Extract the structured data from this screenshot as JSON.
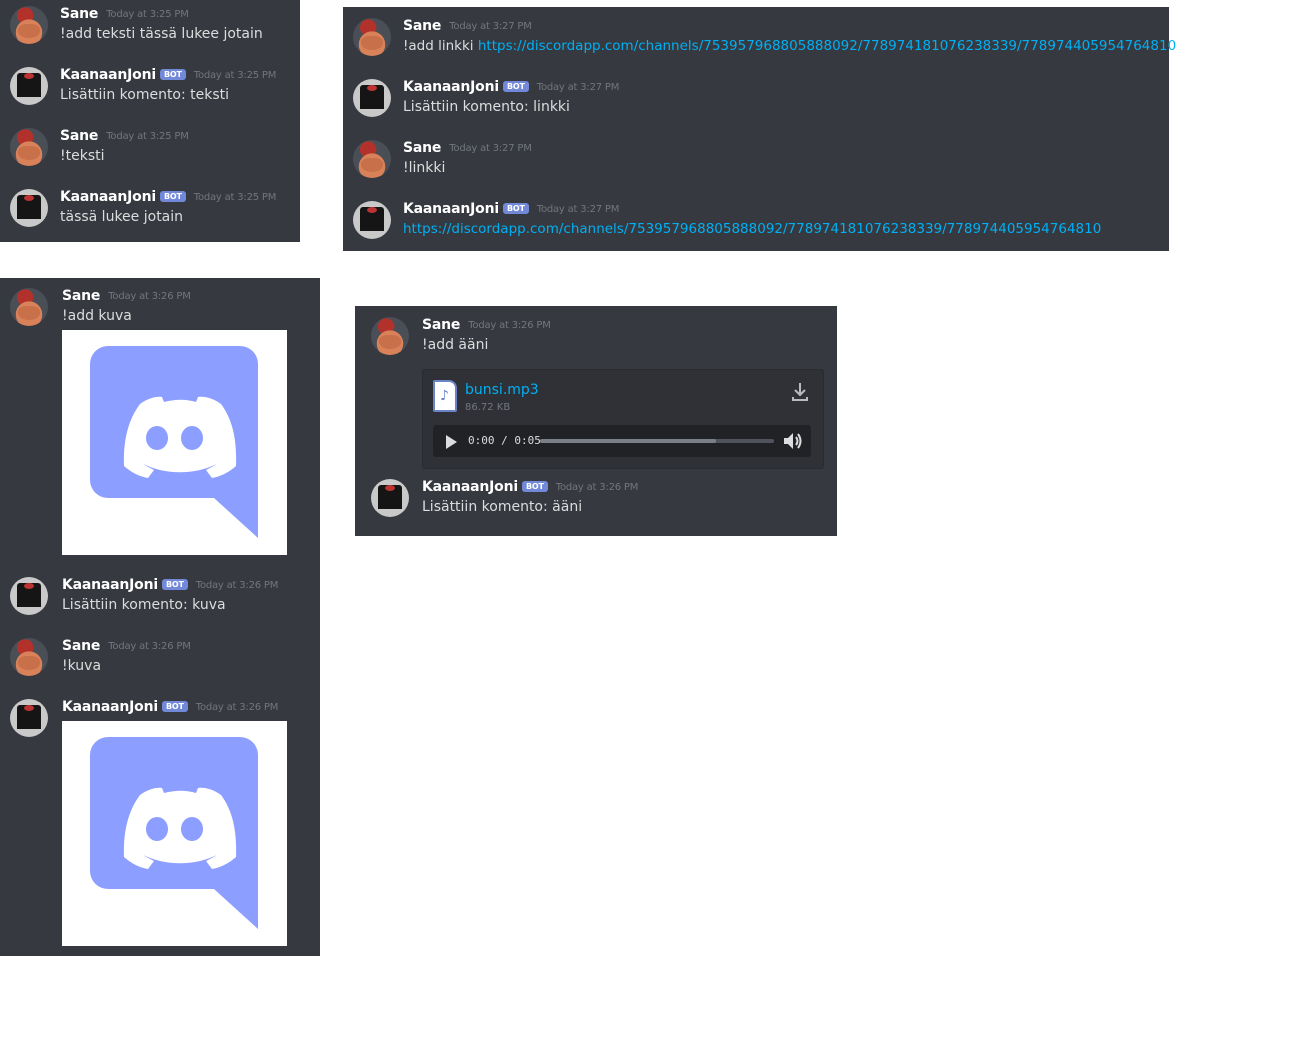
{
  "panel1": {
    "messages": [
      {
        "user": "Sane",
        "bot": false,
        "time": "Today at 3:25 PM",
        "text": "!add teksti tässä lukee jotain"
      },
      {
        "user": "KaanaanJoni",
        "bot": true,
        "time": "Today at 3:25 PM",
        "text": "Lisättiin komento: teksti"
      },
      {
        "user": "Sane",
        "bot": false,
        "time": "Today at 3:25 PM",
        "text": "!teksti"
      },
      {
        "user": "KaanaanJoni",
        "bot": true,
        "time": "Today at 3:25 PM",
        "text": "tässä lukee jotain"
      }
    ]
  },
  "panel2": {
    "messages": [
      {
        "user": "Sane",
        "bot": false,
        "time": "Today at 3:27 PM",
        "text": "!add linkki ",
        "link": "https://discordapp.com/channels/753957968805888092/778974181076238339/778974405954764810"
      },
      {
        "user": "KaanaanJoni",
        "bot": true,
        "time": "Today at 3:27 PM",
        "text": "Lisättiin komento: linkki"
      },
      {
        "user": "Sane",
        "bot": false,
        "time": "Today at 3:27 PM",
        "text": "!linkki"
      },
      {
        "user": "KaanaanJoni",
        "bot": true,
        "time": "Today at 3:27 PM",
        "link": "https://discordapp.com/channels/753957968805888092/778974181076238339/778974405954764810"
      }
    ]
  },
  "panel3": {
    "messages": [
      {
        "user": "Sane",
        "bot": false,
        "time": "Today at 3:26 PM",
        "text": "!add kuva"
      },
      {
        "user": "KaanaanJoni",
        "bot": true,
        "time": "Today at 3:26 PM",
        "text": "Lisättiin komento: kuva"
      },
      {
        "user": "Sane",
        "bot": false,
        "time": "Today at 3:26 PM",
        "text": "!kuva"
      },
      {
        "user": "KaanaanJoni",
        "bot": true,
        "time": "Today at 3:26 PM"
      }
    ],
    "image_icon": "discord-logo-icon"
  },
  "panel4": {
    "messages": [
      {
        "user": "Sane",
        "bot": false,
        "time": "Today at 3:26 PM",
        "text": "!add ääni"
      },
      {
        "user": "KaanaanJoni",
        "bot": true,
        "time": "Today at 3:26 PM",
        "text": "Lisättiin komento: ääni"
      }
    ],
    "attachment": {
      "filename": "bunsi.mp3",
      "size": "86.72 KB",
      "time_current": "0:00",
      "time_sep": " / ",
      "time_total": "0:05",
      "progress": 0.75
    }
  },
  "badge_label": "BOT",
  "colors": {
    "background": "#36393f",
    "username": "#ffffff",
    "text": "#dcddde",
    "timestamp": "#72767d",
    "link": "#00b0f4",
    "badge": "#7289da",
    "discord_blurple": "#8c9eff"
  }
}
